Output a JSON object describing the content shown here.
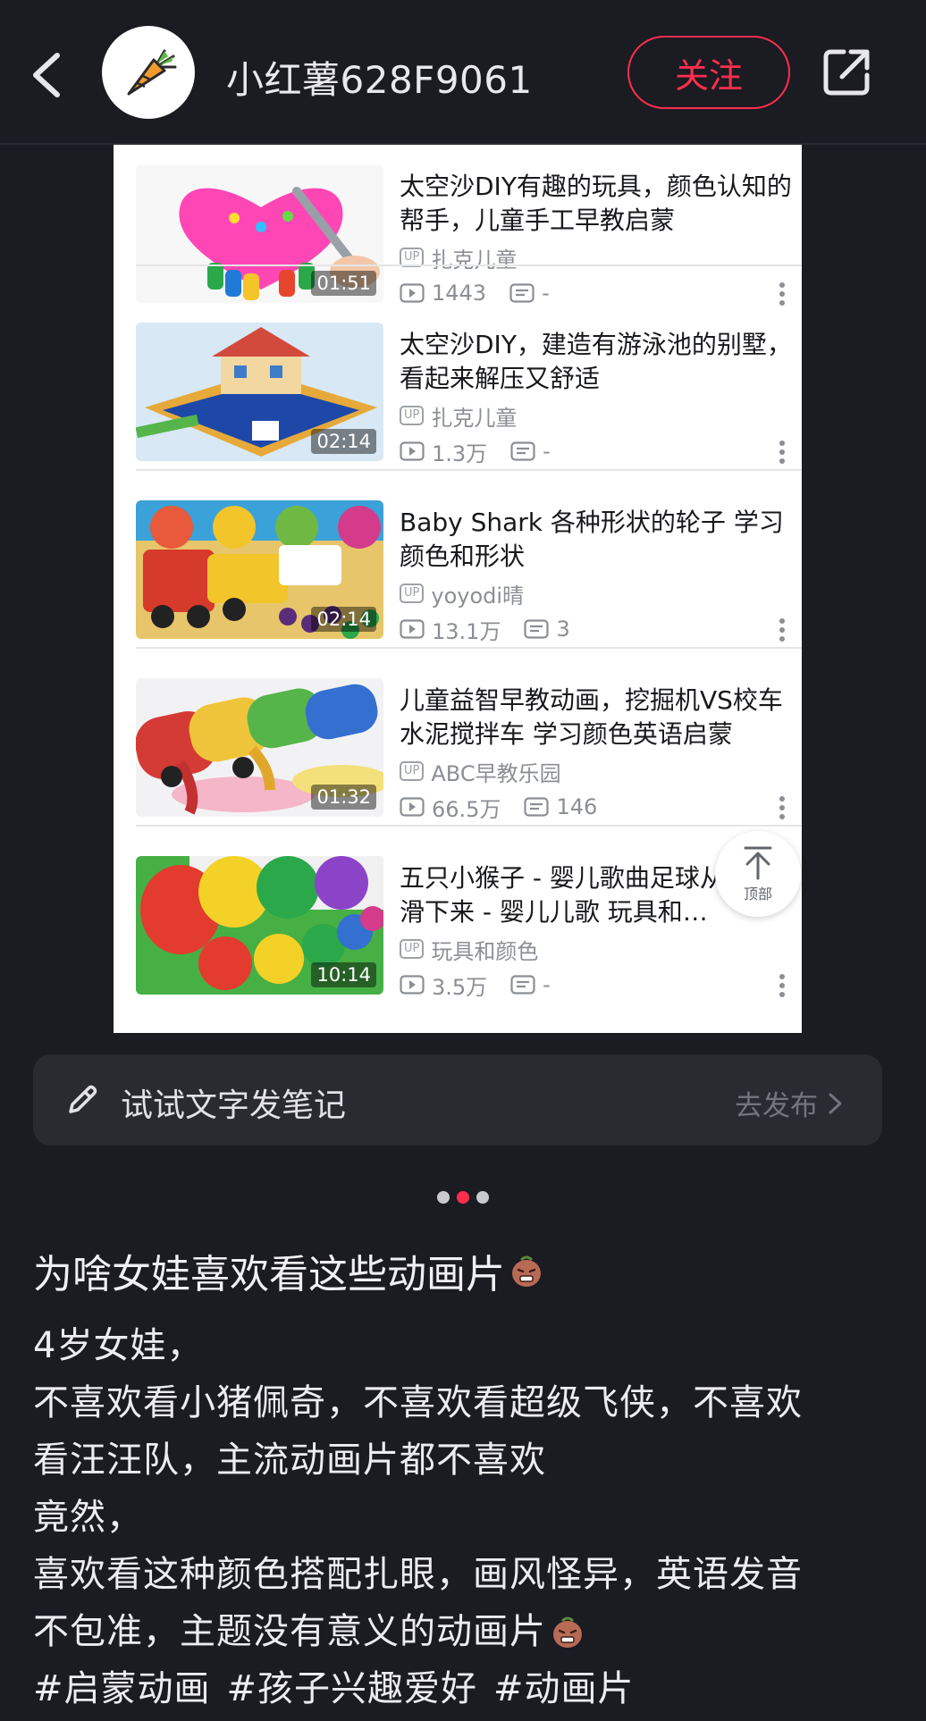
{
  "header": {
    "username": "小红薯628F9061",
    "follow_label": "关注"
  },
  "videos": [
    {
      "title": "太空沙DIY有趣的玩具，颜色认知的帮手，儿童手工早教启蒙",
      "uploader": "扎克儿童",
      "views": "1443",
      "comments": "-",
      "duration": "01:51",
      "thumb_colors": [
        "#ff46b5",
        "#f7f7f7",
        "#2ba84a"
      ]
    },
    {
      "title": "太空沙DIY，建造有游泳池的别墅，看起来解压又舒适",
      "uploader": "扎克儿童",
      "views": "1.3万",
      "comments": "-",
      "duration": "02:14",
      "thumb_colors": [
        "#d8e8f5",
        "#1d48a8",
        "#d24a3c"
      ]
    },
    {
      "title": "Baby Shark 各种形状的轮子 学习颜色和形状",
      "uploader": "yoyodi晴",
      "views": "13.1万",
      "comments": "3",
      "duration": "02:14",
      "thumb_colors": [
        "#e7c66b",
        "#d63a2b",
        "#f2c52a"
      ]
    },
    {
      "title": "儿童益智早教动画，挖掘机VS校车水泥搅拌车 学习颜色英语启蒙",
      "uploader": "ABC早教乐园",
      "views": "66.5万",
      "comments": "146",
      "duration": "01:32",
      "thumb_colors": [
        "#f2f2f4",
        "#d43b34",
        "#f0c43a"
      ]
    },
    {
      "title": "五只小猴子 - 婴儿歌曲足球从梯上滑下来 - 婴儿儿歌 玩具和…",
      "uploader": "玩具和颜色",
      "views": "3.5万",
      "comments": "-",
      "duration": "10:14",
      "thumb_colors": [
        "#46b045",
        "#e33b2e",
        "#f4d127"
      ]
    }
  ],
  "up_badge": "UP",
  "back_to_top_label": "顶部",
  "note_bar": {
    "prompt": "试试文字发笔记",
    "publish_label": "去发布"
  },
  "post": {
    "title": "为啥女娃喜欢看这些动画片",
    "lines": [
      "4岁女娃，",
      "不喜欢看小猪佩奇，不喜欢看超级飞侠，不喜欢",
      "看汪汪队，主流动画片都不喜欢",
      "竟然，",
      "喜欢看这种颜色搭配扎眼，画风怪异，英语发音",
      "不包准，主题没有意义的动画片"
    ],
    "tags": [
      "#启蒙动画",
      "#孩子兴趣爱好",
      "#动画片"
    ]
  },
  "colors": {
    "background": "#1b1b22",
    "accent": "#ff2e4d"
  }
}
